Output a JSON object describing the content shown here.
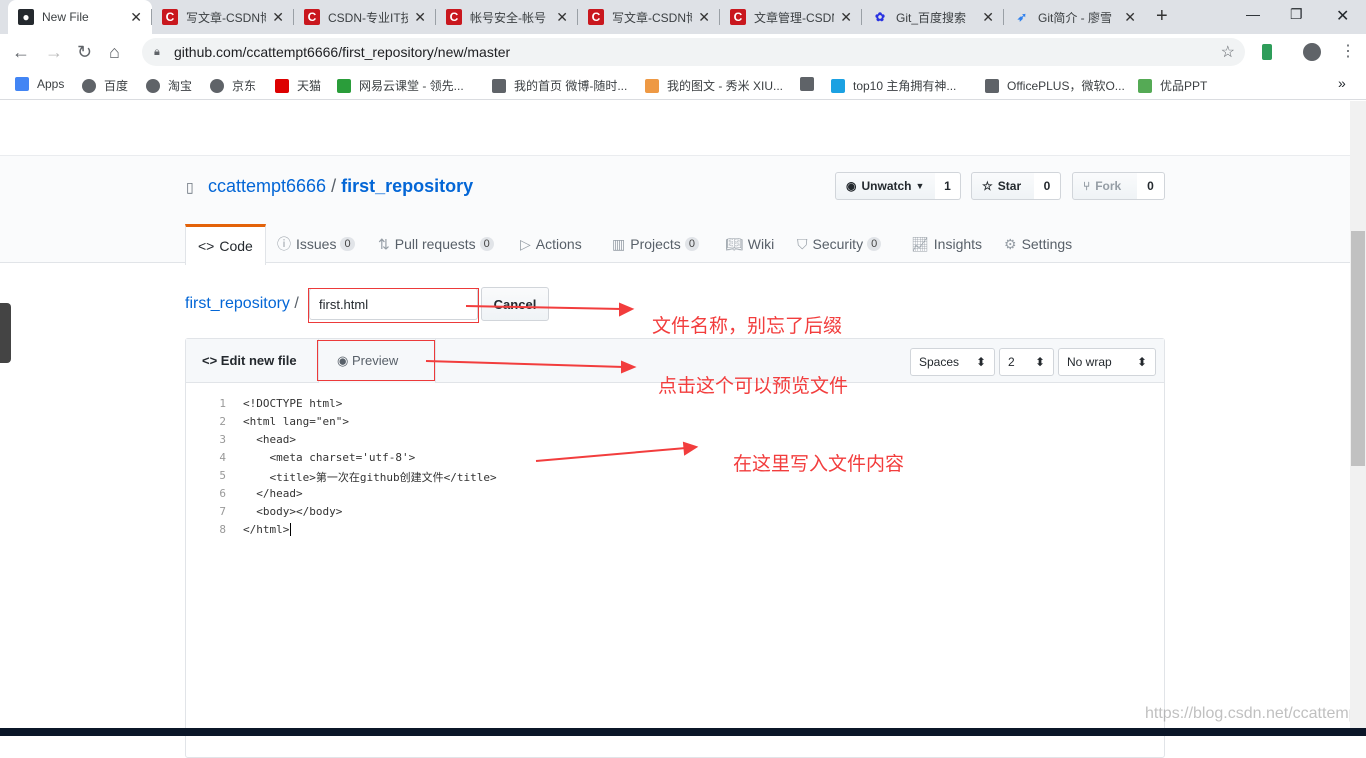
{
  "browser": {
    "tabs": [
      {
        "title": "New File",
        "icon": "github-icon",
        "color": "#24292e"
      },
      {
        "title": "写文章-CSDN博",
        "icon": "csdn-icon",
        "color": "#c9171e"
      },
      {
        "title": "CSDN-专业IT技",
        "icon": "csdn-icon",
        "color": "#c9171e"
      },
      {
        "title": "帐号安全-帐号",
        "icon": "csdn-icon",
        "color": "#c9171e"
      },
      {
        "title": "写文章-CSDN博",
        "icon": "csdn-icon",
        "color": "#c9171e"
      },
      {
        "title": "文章管理-CSDN",
        "icon": "csdn-icon",
        "color": "#c9171e"
      },
      {
        "title": "Git_百度搜索",
        "icon": "baidu-icon",
        "color": "#2932e1"
      },
      {
        "title": "Git简介 - 廖雪",
        "icon": "rocket-icon",
        "color": "#2f80ed"
      }
    ],
    "url": "github.com/ccattempt6666/first_repository/new/master",
    "bookmarks": [
      "Apps",
      "百度",
      "淘宝",
      "京东",
      "天猫",
      "网易云课堂 - 领先...",
      "我的首页 微博-随时...",
      "我的图文 - 秀米 XIU...",
      "",
      "top10 主角拥有神...",
      "OfficePLUS，微软O...",
      "优品PPT"
    ]
  },
  "repo": {
    "owner": "ccattempt6666",
    "sep": "/",
    "name": "first_repository",
    "unwatch": "Unwatch",
    "watch_count": "1",
    "star": "Star",
    "star_count": "0",
    "fork": "Fork",
    "fork_count": "0",
    "tabs": [
      {
        "label": "Code"
      },
      {
        "label": "Issues",
        "count": "0"
      },
      {
        "label": "Pull requests",
        "count": "0"
      },
      {
        "label": "Actions"
      },
      {
        "label": "Projects",
        "count": "0"
      },
      {
        "label": "Wiki"
      },
      {
        "label": "Security",
        "count": "0"
      },
      {
        "label": "Insights"
      },
      {
        "label": "Settings"
      }
    ]
  },
  "editor": {
    "breadcrumb": "first_repository",
    "slash": "/",
    "filename": "first.html",
    "cancel": "Cancel",
    "edit_tab": "Edit new file",
    "preview_tab": "Preview",
    "indent_mode": "Spaces",
    "indent_size": "2",
    "wrap_mode": "No wrap",
    "lines": [
      "<!DOCTYPE html>",
      "<html lang=\"en\">",
      "  <head>",
      "    <meta charset='utf-8'>",
      "    <title>第一次在github创建文件</title>",
      "  </head>",
      "  <body></body>",
      "</html>"
    ]
  },
  "annotations": {
    "filename_note": "文件名称，别忘了后缀",
    "preview_note": "点击这个可以预览文件",
    "content_note": "在这里写入文件内容",
    "color": "#f23d3d"
  },
  "watermark": "https://blog.csdn.net/ccattempt"
}
